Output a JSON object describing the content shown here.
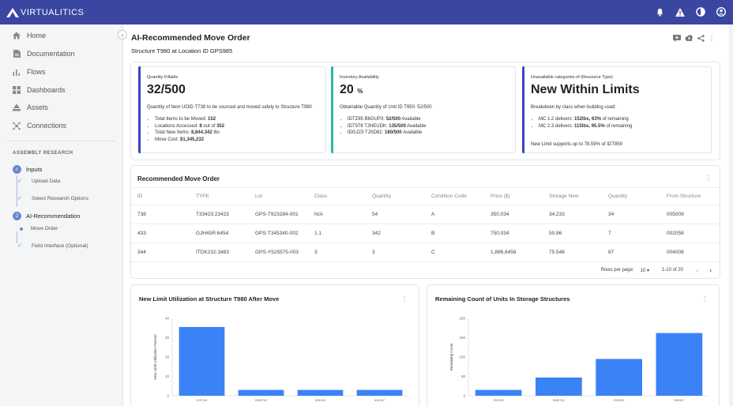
{
  "app": {
    "logo_text": "VIRTUALITICS"
  },
  "colors": {
    "topbar": "#3a46a0",
    "accent": "#3b7cf0",
    "bar_blue": "#3b82f6",
    "kpi_bar": "#3a46c0",
    "kpi_bar_green": "#2fb5a0"
  },
  "topbar_icons": [
    "bell-icon",
    "alert-icon",
    "theme-icon",
    "user-icon"
  ],
  "sidebar": {
    "nav": [
      {
        "label": "Home",
        "icon": "home-icon"
      },
      {
        "label": "Documentation",
        "icon": "document-icon"
      },
      {
        "label": "Flows",
        "icon": "flows-icon"
      },
      {
        "label": "Dashboards",
        "icon": "dashboards-icon"
      },
      {
        "label": "Assets",
        "icon": "assets-icon"
      },
      {
        "label": "Connections",
        "icon": "connections-icon"
      }
    ],
    "section_label": "ASSEMBLY RESEARCH",
    "steps": [
      {
        "label": "Inputs",
        "marker": "✓",
        "substeps": [
          "Upload Data",
          "Select Research Options"
        ]
      },
      {
        "label": "AI-Recommendation",
        "marker": "2",
        "substeps": [
          "Move Order",
          "Field Interface (Optional)"
        ]
      }
    ]
  },
  "page": {
    "title": "AI-Recommended Move Order",
    "subtitle": "Structure T980 at Location ID GPS985"
  },
  "kpis": [
    {
      "label": "Quantity Fillable",
      "value": "32/500",
      "unit": "",
      "desc": "Quantity of Item UOID T738 to be sourced and moved safely to Structure T980",
      "items": [
        {
          "pre": "Total Items to be Moved: ",
          "bold": "152",
          "post": ""
        },
        {
          "pre": "Locations Accessed: ",
          "bold": "8",
          "post": " out of ",
          "bold2": "352"
        },
        {
          "pre": "Total New Items: ",
          "bold": "8,844.342",
          "post": " lbs"
        },
        {
          "pre": "Move Cost: ",
          "bold": "$1,345,232",
          "post": ""
        }
      ]
    },
    {
      "label": "Inventory Availability",
      "value": "20",
      "unit": "%",
      "desc": "Obtainable Quantity of Unit ID T950: 52/500",
      "items": [
        {
          "pre": "IDTZ85 B6GUP3: ",
          "bold": "52/500",
          "post": " Available"
        },
        {
          "pre": "IDT978 TJHEUDK: ",
          "bold": "135/500",
          "post": " Available"
        },
        {
          "pre": "IDGJ23 TJSD82: ",
          "bold": "180/500",
          "post": " Available"
        }
      ]
    },
    {
      "label": "Unavailable categories of (Resource Type)",
      "value": "New Within Limits",
      "unit": "",
      "desc": "Breakdown by class when building used:",
      "items": [
        {
          "pre": "MC 1.2 delivers: ",
          "bold": "152lbs, 63%",
          "post": " of remaining"
        },
        {
          "pre": "MC 2.3 delivers: ",
          "bold": "115lbs, 95.5%",
          "post": " of remaining"
        }
      ],
      "footer": "New Limit supports up to 78.59% of IDT850"
    }
  ],
  "table": {
    "title": "Recommended Move Order",
    "columns": [
      "ID",
      "TYPE",
      "Lot",
      "Class",
      "Quantity",
      "Condition Code",
      "Price ($)",
      "Storage New",
      "Quantity",
      "From Structure"
    ],
    "rows": [
      [
        "738",
        "T33423:23423",
        "GPS-T923284-001",
        "N/A",
        "54",
        "A",
        "350,034",
        "34.233",
        "34",
        "005009"
      ],
      [
        "433",
        "GJH45R:6454",
        "GPS-T345340-002",
        "1.1",
        "342",
        "B",
        "750,034",
        "50.86",
        "7",
        "002058"
      ],
      [
        "344",
        "ITDK232:3483",
        "GPS-Y525575-003",
        "3",
        "3",
        "C",
        "1,896,6458",
        "75.548",
        "87",
        "004008"
      ]
    ],
    "rows_per_page_label": "Rows per page:",
    "rows_per_page": "10",
    "range": "1-10 of 20"
  },
  "chart_data": [
    {
      "type": "bar",
      "title": "New Limit Utilization at Structure T980 After Move",
      "ylabel": "New Limit Utilization Percent",
      "xlabel": "",
      "categories": [
        "ID3745",
        "ID83742",
        "ID9343",
        "ID8347"
      ],
      "values": [
        35.5,
        3,
        3,
        3
      ],
      "ylim": [
        0,
        40
      ],
      "yticks": [
        0,
        10,
        20,
        30,
        40
      ],
      "grid": false
    },
    {
      "type": "bar",
      "title": "Remaining Count of Units In Storage Structures",
      "ylabel": "Remaining Count",
      "xlabel": "",
      "categories": [
        "ID3745",
        "ID83742",
        "ID9343",
        "ID8347"
      ],
      "values": [
        15,
        47,
        95,
        162
      ],
      "ylim": [
        0,
        200
      ],
      "yticks": [
        0,
        50,
        100,
        150,
        200
      ],
      "grid": false
    }
  ]
}
